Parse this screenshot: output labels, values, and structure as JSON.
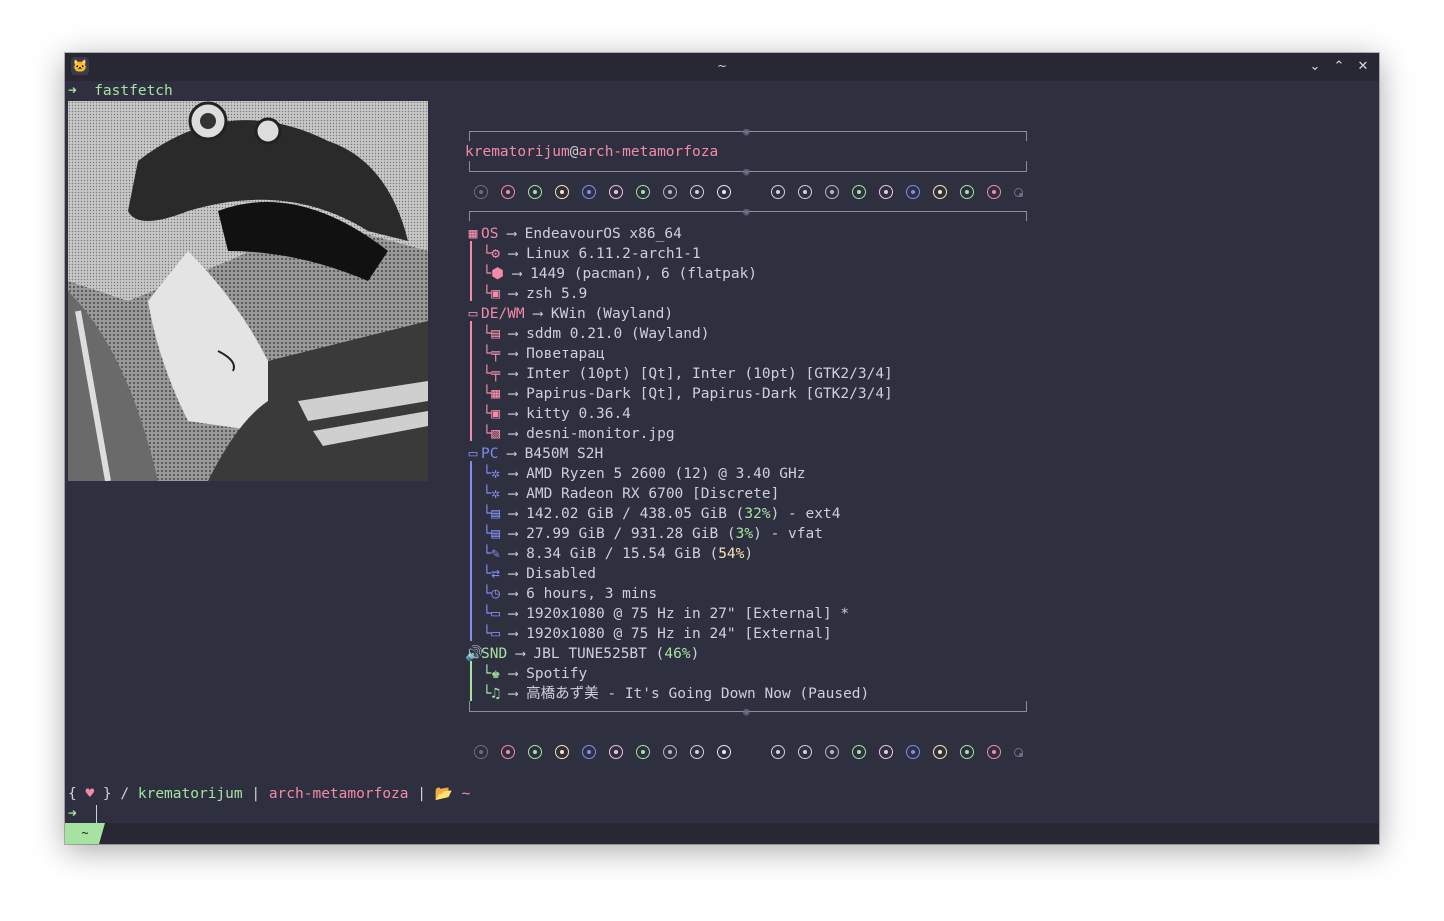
{
  "window": {
    "title": "~"
  },
  "prompt1": {
    "arrow": "➜",
    "command": "fastfetch"
  },
  "header": {
    "user": "krematorijum",
    "at": "@",
    "host": "arch-metamorfoza"
  },
  "colors": {
    "green": "#a6e3a1",
    "pink": "#f38ba8",
    "yellow": "#f9e2af",
    "blue": "#7f8cf0",
    "white": "#cdd0da",
    "dim": "#6c6f85"
  },
  "dot_colors": [
    "#6c6f85",
    "#f38ba8",
    "#a6e3a1",
    "#f9e2af",
    "#7f8cf0",
    "#f5c2e7",
    "#a6e3a1",
    "#b4b8c8",
    "#cdd0da",
    "#e6e9f0"
  ],
  "dot_colors2": [
    "#cdd0da",
    "#cdd0da",
    "#b4b8c8",
    "#a6e3a1",
    "#f5c2e7",
    "#7f8cf0",
    "#f9e2af",
    "#a6e3a1",
    "#f38ba8"
  ],
  "arrow": "⟶",
  "sections": {
    "os": {
      "label": "OS",
      "value": "EndeavourOS x86_64",
      "items": [
        "Linux 6.11.2-arch1-1",
        "1449 (pacman), 6 (flatpak)",
        "zsh 5.9"
      ]
    },
    "de": {
      "label": "DE/WM",
      "value": "KWin (Wayland)",
      "items": [
        "sddm 0.21.0 (Wayland)",
        "Поветарац",
        "Inter (10pt) [Qt], Inter (10pt) [GTK2/3/4]",
        "Papirus-Dark [Qt], Papirus-Dark [GTK2/3/4]",
        "kitty 0.36.4",
        "desni-monitor.jpg"
      ]
    },
    "pc": {
      "label": "PC",
      "value": "B450M S2H",
      "items": [
        "AMD Ryzen 5 2600 (12) @ 3.40 GHz",
        "AMD Radeon RX 6700 [Discrete]"
      ],
      "disk1": {
        "pre": "142.02 GiB / 438.05 GiB (",
        "pct": "32%",
        "post": ") - ext4"
      },
      "disk2": {
        "pre": "27.99 GiB / 931.28 GiB (",
        "pct": "3%",
        "post": ") - vfat"
      },
      "mem": {
        "pre": "8.34 GiB / 15.54 GiB (",
        "pct": "54%",
        "post": ")"
      },
      "items2": [
        "Disabled",
        "6 hours, 3 mins",
        "1920x1080 @ 75 Hz in 27\" [External] *",
        "1920x1080 @ 75 Hz in 24\" [External]"
      ]
    },
    "snd": {
      "label": "SND",
      "pre": "JBL TUNE525BT (",
      "pct": "46%",
      "post": ")",
      "items": [
        "Spotify",
        "高橋あず美 - It's Going Down Now (Paused)"
      ]
    }
  },
  "prompt2": {
    "open": "{ ",
    "heart": "♥",
    "close": " } / ",
    "user": "krematorijum",
    "sep1": " | ",
    "host": "arch-metamorfoza",
    "sep2": " | ",
    "folder": "📂",
    "dir": " ~"
  },
  "prompt3": {
    "arrow": "➜"
  },
  "tab": {
    "label": "~"
  }
}
